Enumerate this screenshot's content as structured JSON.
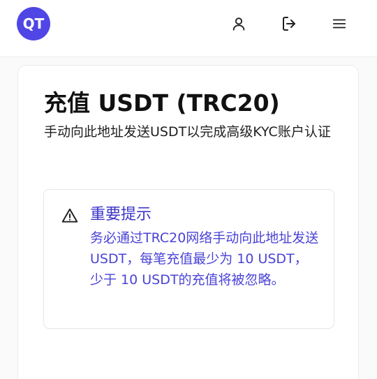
{
  "header": {
    "logo_text": "QT",
    "user_icon": "user-icon",
    "logout_icon": "logout-icon",
    "menu_icon": "menu-icon"
  },
  "main": {
    "title": "充值 USDT (TRC20)",
    "subtitle": "手动向此地址发送USDT以完成高级KYC账户认证"
  },
  "alert": {
    "icon": "warning-icon",
    "title": "重要提示",
    "body": "务必通过TRC20网络手动向此地址发送USDT，每笔充值最少为 10 USDT，少于 10 USDT的充值将被忽略。"
  },
  "colors": {
    "accent": "#4f46e5",
    "alert_text": "#4a43d6"
  }
}
